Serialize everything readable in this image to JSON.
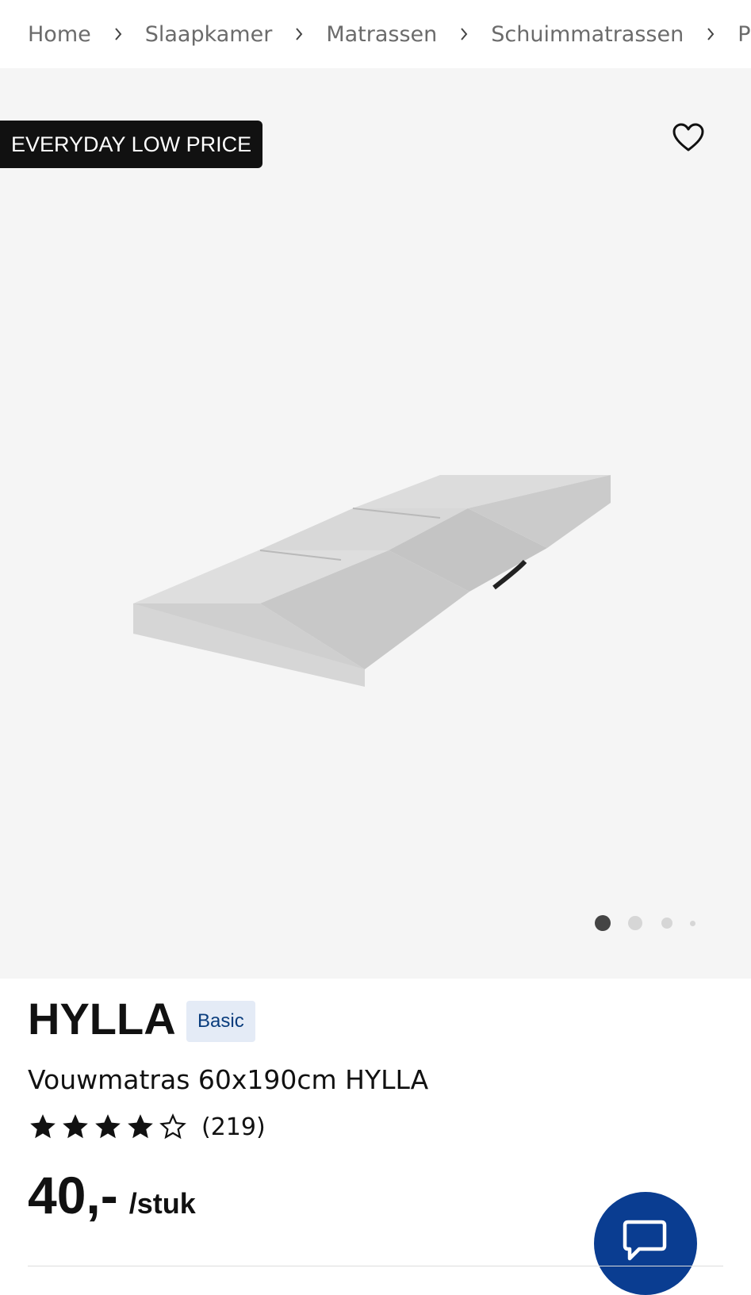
{
  "breadcrumb": {
    "items": [
      "Home",
      "Slaapkamer",
      "Matrassen",
      "Schuimmatrassen",
      "Produ"
    ]
  },
  "gallery": {
    "badge": "EVERYDAY LOW PRICE",
    "favorite_icon": "heart-outline-icon",
    "image_alt": "Vouwmatras 60x190cm HYLLA",
    "total_images": 4,
    "active_image": 1
  },
  "product": {
    "name": "HYLLA",
    "tag": "Basic",
    "description": "Vouwmatras 60x190cm HYLLA",
    "rating": 4,
    "rating_max": 5,
    "review_count": "(219)",
    "price": "40,-",
    "price_unit": "/stuk"
  },
  "chat": {
    "icon": "chat-bubble-icon"
  },
  "colors": {
    "accent": "#0a3d91",
    "tag_bg": "#e4ebf6",
    "tag_text": "#0a3d7d",
    "badge_bg": "#111111"
  }
}
